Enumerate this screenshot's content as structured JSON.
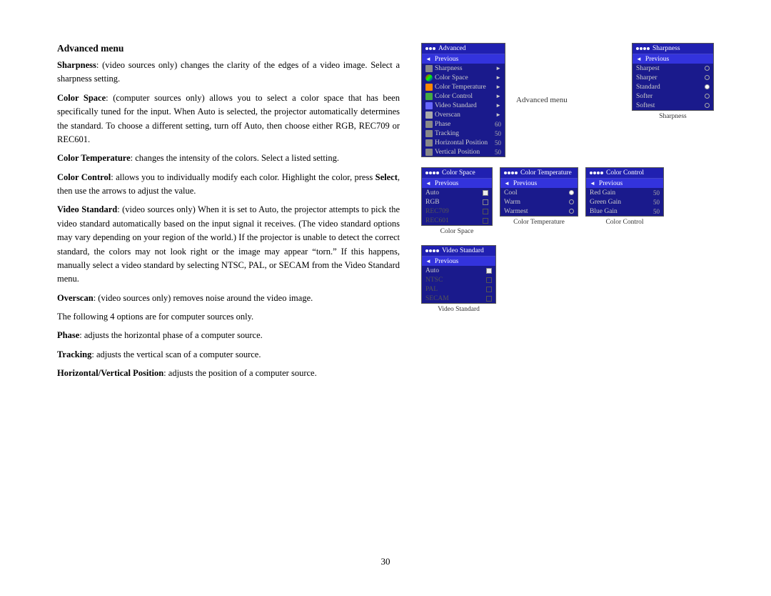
{
  "page": {
    "number": "30",
    "title": "Advanced menu",
    "paragraphs": [
      {
        "id": "sharpness",
        "bold_start": "Sharpness",
        "text": ": (video sources only) changes the clarity of the edges of a video image. Select a sharpness setting."
      },
      {
        "id": "color_space",
        "bold_start": "Color Space",
        "text": ": (computer sources only) allows you to select a color space that has been specifically tuned for the input. When Auto is selected, the projector automatically determines the standard. To choose a different setting, turn off Auto, then choose either RGB, REC709 or REC601."
      },
      {
        "id": "color_temp",
        "bold_start": "Color Temperature",
        "text": ": changes the intensity of the colors. Select a listed setting."
      },
      {
        "id": "color_control",
        "bold_start": "Color Control",
        "text": ": allows you to individually modify each color. Highlight the color, press Select, then use the arrows to adjust the value."
      },
      {
        "id": "video_standard",
        "bold_start": "Video Standard",
        "text": ": (video sources only) When it is set to Auto, the projector attempts to pick the video standard automatically based on the input signal it receives. (The video standard options may vary depending on your region of the world.) If the projector is unable to detect the correct standard, the colors may not look right or the image may appear “torn.” If this happens, manually select a video standard by selecting NTSC, PAL, or SECAM from the Video Standard menu."
      },
      {
        "id": "overscan",
        "bold_start": "Overscan",
        "text": ": (video sources only) removes noise around the video image."
      },
      {
        "id": "following",
        "bold_start": "",
        "text": "The following 4 options are for computer sources only."
      },
      {
        "id": "phase",
        "bold_start": "Phase",
        "text": ": adjusts the horizontal phase of a computer source."
      },
      {
        "id": "tracking",
        "bold_start": "Tracking",
        "text": ": adjusts the vertical scan of a computer source."
      },
      {
        "id": "hvposition",
        "bold_start": "Horizontal/Vertical Position",
        "text": ": adjusts the position of a computer source."
      }
    ]
  },
  "menus": {
    "advanced_label": "Advanced menu",
    "advanced": {
      "title": "Advanced",
      "items": [
        {
          "label": "Previous",
          "type": "nav",
          "selected": true
        },
        {
          "label": "Sharpness",
          "type": "arrow",
          "icon": "brightness"
        },
        {
          "label": "Color Space",
          "type": "arrow",
          "icon": "colorspace"
        },
        {
          "label": "Color Temperature",
          "type": "arrow",
          "icon": "colortemp"
        },
        {
          "label": "Color Control",
          "type": "arrow",
          "icon": "colorcontrol"
        },
        {
          "label": "Video Standard",
          "type": "arrow",
          "icon": "videostandard"
        },
        {
          "label": "Overscan",
          "type": "arrow",
          "icon": "overscan"
        },
        {
          "label": "Phase",
          "type": "value",
          "value": "60"
        },
        {
          "label": "Tracking",
          "type": "value",
          "value": "50"
        },
        {
          "label": "Horizontal Position",
          "type": "value",
          "value": "50"
        },
        {
          "label": "Vertical Position",
          "type": "value",
          "value": "50"
        }
      ]
    },
    "sharpness": {
      "title": "Sharpness",
      "items": [
        {
          "label": "Previous",
          "type": "nav",
          "selected": true
        },
        {
          "label": "Sharpest",
          "type": "radio",
          "checked": false
        },
        {
          "label": "Sharper",
          "type": "radio",
          "checked": false
        },
        {
          "label": "Standard",
          "type": "radio",
          "checked": true
        },
        {
          "label": "Softer",
          "type": "radio",
          "checked": false
        },
        {
          "label": "Softest",
          "type": "radio",
          "checked": false
        }
      ],
      "label": "Sharpness"
    },
    "color_space": {
      "title": "Color Space",
      "items": [
        {
          "label": "Previous",
          "type": "nav",
          "selected": true
        },
        {
          "label": "Auto",
          "type": "check",
          "checked": true
        },
        {
          "label": "RGB",
          "type": "check",
          "checked": false
        },
        {
          "label": "REC709",
          "type": "check",
          "checked": false,
          "disabled": true
        },
        {
          "label": "REC601",
          "type": "check",
          "checked": false,
          "disabled": true
        }
      ],
      "label": "Color Space"
    },
    "color_temperature": {
      "title": "Color Temperature",
      "items": [
        {
          "label": "Previous",
          "type": "nav",
          "selected": true
        },
        {
          "label": "Cool",
          "type": "radio",
          "checked": true
        },
        {
          "label": "Warm",
          "type": "radio",
          "checked": false
        },
        {
          "label": "Warmest",
          "type": "radio",
          "checked": false
        }
      ],
      "label": "Color Temperature"
    },
    "color_control": {
      "title": "Color Control",
      "items": [
        {
          "label": "Previous",
          "type": "nav",
          "selected": true
        },
        {
          "label": "Red Gain",
          "type": "value",
          "value": "50"
        },
        {
          "label": "Green Gain",
          "type": "value",
          "value": "50"
        },
        {
          "label": "Blue Gain",
          "type": "value",
          "value": "50"
        }
      ],
      "label": "Color Control"
    },
    "video_standard": {
      "title": "Video Standard",
      "items": [
        {
          "label": "Previous",
          "type": "nav",
          "selected": true
        },
        {
          "label": "Auto",
          "type": "check",
          "checked": true
        },
        {
          "label": "NTSC",
          "type": "check",
          "checked": false,
          "disabled": true
        },
        {
          "label": "PAL",
          "type": "check",
          "checked": false,
          "disabled": true
        },
        {
          "label": "SECAM",
          "type": "check",
          "checked": false,
          "disabled": true
        }
      ],
      "label": "Video Standard"
    }
  }
}
